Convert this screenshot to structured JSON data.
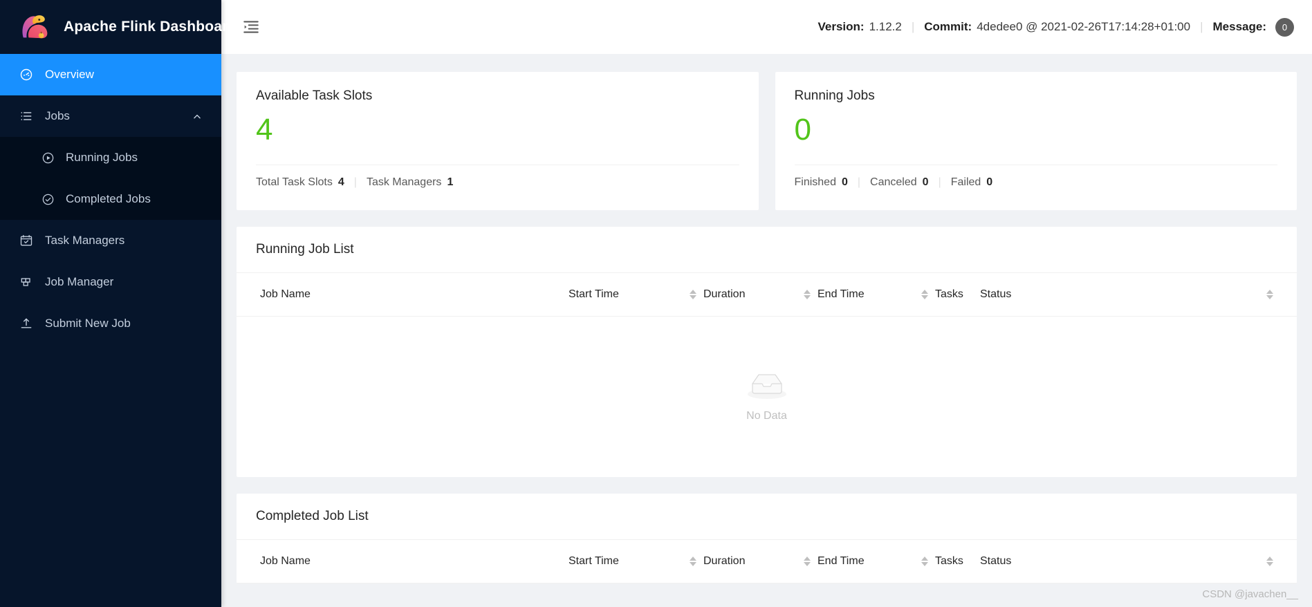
{
  "brand": {
    "title": "Apache Flink Dashboard",
    "logo_icon": "flink-squirrel-logo"
  },
  "sidebar": {
    "items": [
      {
        "label": "Overview",
        "icon": "dashboard-icon",
        "active": true
      },
      {
        "label": "Jobs",
        "icon": "list-icon",
        "active": false,
        "expanded": true,
        "children": [
          {
            "label": "Running Jobs",
            "icon": "play-circle-icon"
          },
          {
            "label": "Completed Jobs",
            "icon": "check-circle-icon"
          }
        ]
      },
      {
        "label": "Task Managers",
        "icon": "task-calendar-icon",
        "active": false
      },
      {
        "label": "Job Manager",
        "icon": "grid-icon",
        "active": false
      },
      {
        "label": "Submit New Job",
        "icon": "upload-icon",
        "active": false
      }
    ]
  },
  "topbar": {
    "menu_fold_icon": "menu-fold-icon",
    "version_label": "Version:",
    "version_value": "1.12.2",
    "commit_label": "Commit:",
    "commit_value": "4dedee0 @ 2021-02-26T17:14:28+01:00",
    "message_label": "Message:",
    "message_count": "0",
    "separator": "|"
  },
  "stats": {
    "task_slots": {
      "title": "Available Task Slots",
      "value": "4",
      "footer": [
        {
          "label": "Total Task Slots",
          "value": "4"
        },
        {
          "label": "Task Managers",
          "value": "1"
        }
      ]
    },
    "running_jobs": {
      "title": "Running Jobs",
      "value": "0",
      "footer": [
        {
          "label": "Finished",
          "value": "0"
        },
        {
          "label": "Canceled",
          "value": "0"
        },
        {
          "label": "Failed",
          "value": "0"
        }
      ]
    }
  },
  "running_job_list": {
    "title": "Running Job List",
    "columns": [
      {
        "label": "Job Name",
        "sortable": false
      },
      {
        "label": "Start Time",
        "sortable": true
      },
      {
        "label": "Duration",
        "sortable": true
      },
      {
        "label": "End Time",
        "sortable": true
      },
      {
        "label": "Tasks",
        "sortable": false
      },
      {
        "label": "Status",
        "sortable": true
      }
    ],
    "rows": [],
    "empty_text": "No Data",
    "empty_icon": "empty-inbox-icon"
  },
  "completed_job_list": {
    "title": "Completed Job List",
    "columns": [
      {
        "label": "Job Name",
        "sortable": false
      },
      {
        "label": "Start Time",
        "sortable": true
      },
      {
        "label": "Duration",
        "sortable": true
      },
      {
        "label": "End Time",
        "sortable": true
      },
      {
        "label": "Tasks",
        "sortable": false
      },
      {
        "label": "Status",
        "sortable": true
      }
    ],
    "rows": []
  },
  "watermark": {
    "text": "CSDN @javachen__"
  },
  "colors": {
    "sidebar_bg": "#06152b",
    "submenu_bg": "#020d1c",
    "accent": "#1890ff",
    "stat_green": "#52c41a",
    "content_bg": "#f0f2f5",
    "card_bg": "#ffffff"
  }
}
